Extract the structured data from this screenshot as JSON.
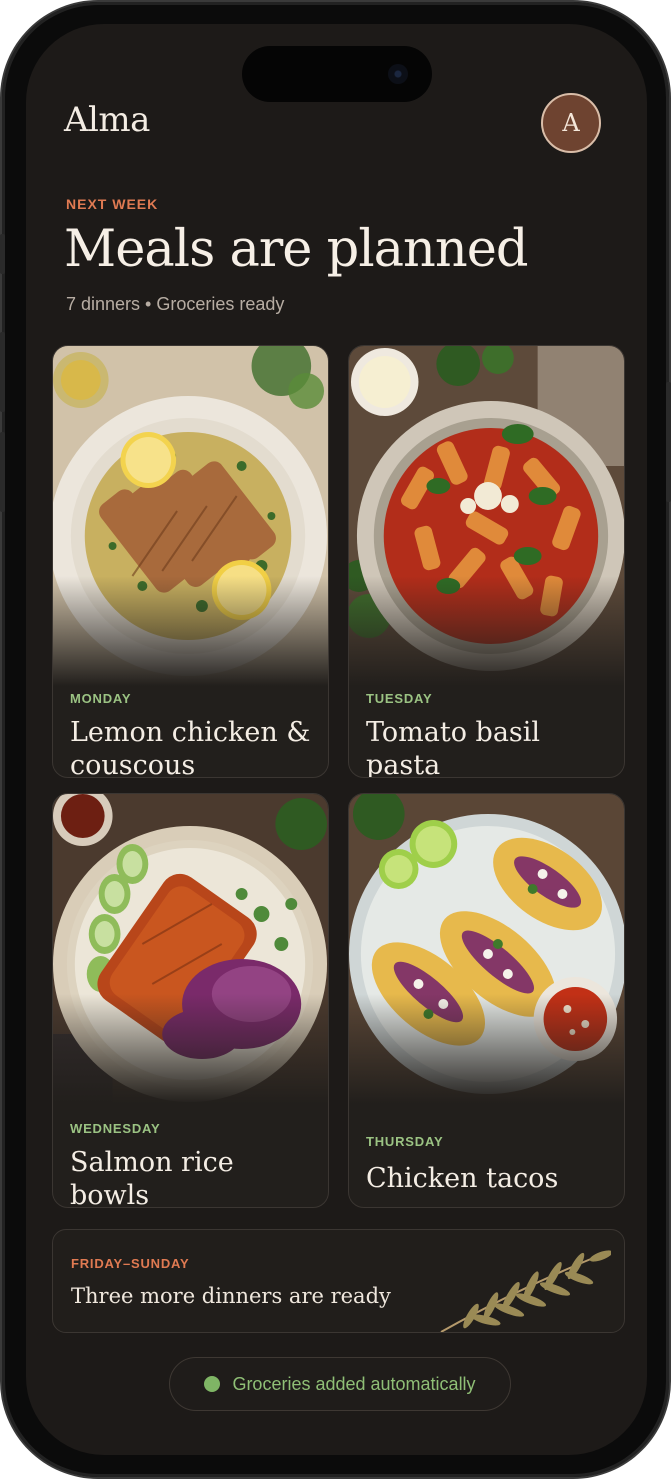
{
  "app": {
    "title": "Alma",
    "avatar_initial": "A"
  },
  "plan": {
    "eyebrow": "NEXT WEEK",
    "headline": "Meals are planned",
    "summary": "7 dinners • Groceries ready"
  },
  "meals": [
    {
      "day": "MONDAY",
      "dish": "Lemon chicken & couscous",
      "icon": "lemon-chicken-couscous-photo"
    },
    {
      "day": "TUESDAY",
      "dish": "Tomato basil pasta",
      "icon": "tomato-basil-pasta-photo"
    },
    {
      "day": "WEDNESDAY",
      "dish": "Salmon rice bowls",
      "icon": "salmon-rice-bowl-photo"
    },
    {
      "day": "THURSDAY",
      "dish": "Chicken tacos",
      "icon": "chicken-tacos-photo"
    }
  ],
  "weekend": {
    "label": "FRIDAY–SUNDAY",
    "text": "Three more dinners are ready",
    "icon": "olive-branch-icon"
  },
  "status": {
    "text": "Groceries added automatically",
    "icon": "status-dot-icon"
  },
  "colors": {
    "background": "#1d1a18",
    "accent_orange": "#e07a52",
    "accent_green": "#9bc383",
    "avatar": "#6e4330"
  }
}
